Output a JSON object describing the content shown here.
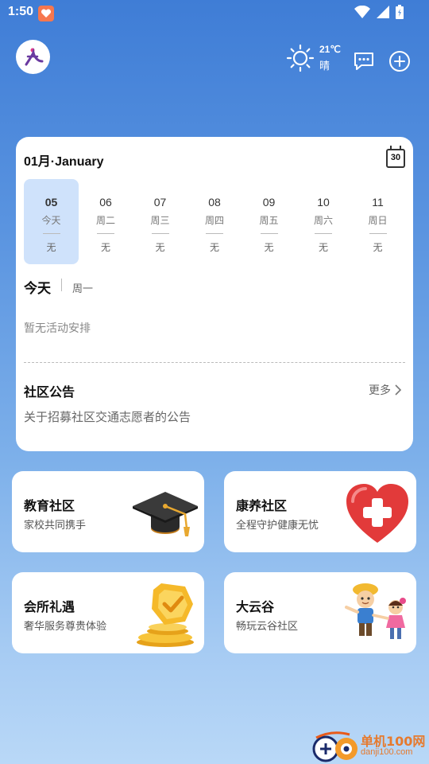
{
  "status_bar": {
    "time": "1:50"
  },
  "header": {
    "weather": {
      "temperature": "21℃",
      "condition": "晴"
    }
  },
  "calendar": {
    "month_title": "01月·January",
    "icon_day": "30",
    "days": [
      {
        "num": "05",
        "week": "今天",
        "activity": "无",
        "active": true
      },
      {
        "num": "06",
        "week": "周二",
        "activity": "无",
        "active": false
      },
      {
        "num": "07",
        "week": "周三",
        "activity": "无",
        "active": false
      },
      {
        "num": "08",
        "week": "周四",
        "activity": "无",
        "active": false
      },
      {
        "num": "09",
        "week": "周五",
        "activity": "无",
        "active": false
      },
      {
        "num": "10",
        "week": "周六",
        "activity": "无",
        "active": false
      },
      {
        "num": "11",
        "week": "周日",
        "activity": "无",
        "active": false
      }
    ],
    "today_label": "今天",
    "today_weekday": "周一",
    "no_activity": "暂无活动安排"
  },
  "notice": {
    "title": "社区公告",
    "more": "更多",
    "items": [
      "关于招募社区交通志愿者的公告"
    ]
  },
  "tiles": [
    {
      "title": "教育社区",
      "subtitle": "家校共同携手",
      "icon": "graduation-cap-icon"
    },
    {
      "title": "康养社区",
      "subtitle": "全程守护健康无忧",
      "icon": "heart-health-icon"
    },
    {
      "title": "会所礼遇",
      "subtitle": "奢华服务尊贵体验",
      "icon": "gold-badge-icon"
    },
    {
      "title": "大云谷",
      "subtitle": "畅玩云谷社区",
      "icon": "kids-icon"
    }
  ],
  "watermark": {
    "name": "单机100网",
    "url": "danji100.com"
  },
  "colors": {
    "accent": "#3f7dd6",
    "active_day_bg": "#cfe2fb"
  }
}
